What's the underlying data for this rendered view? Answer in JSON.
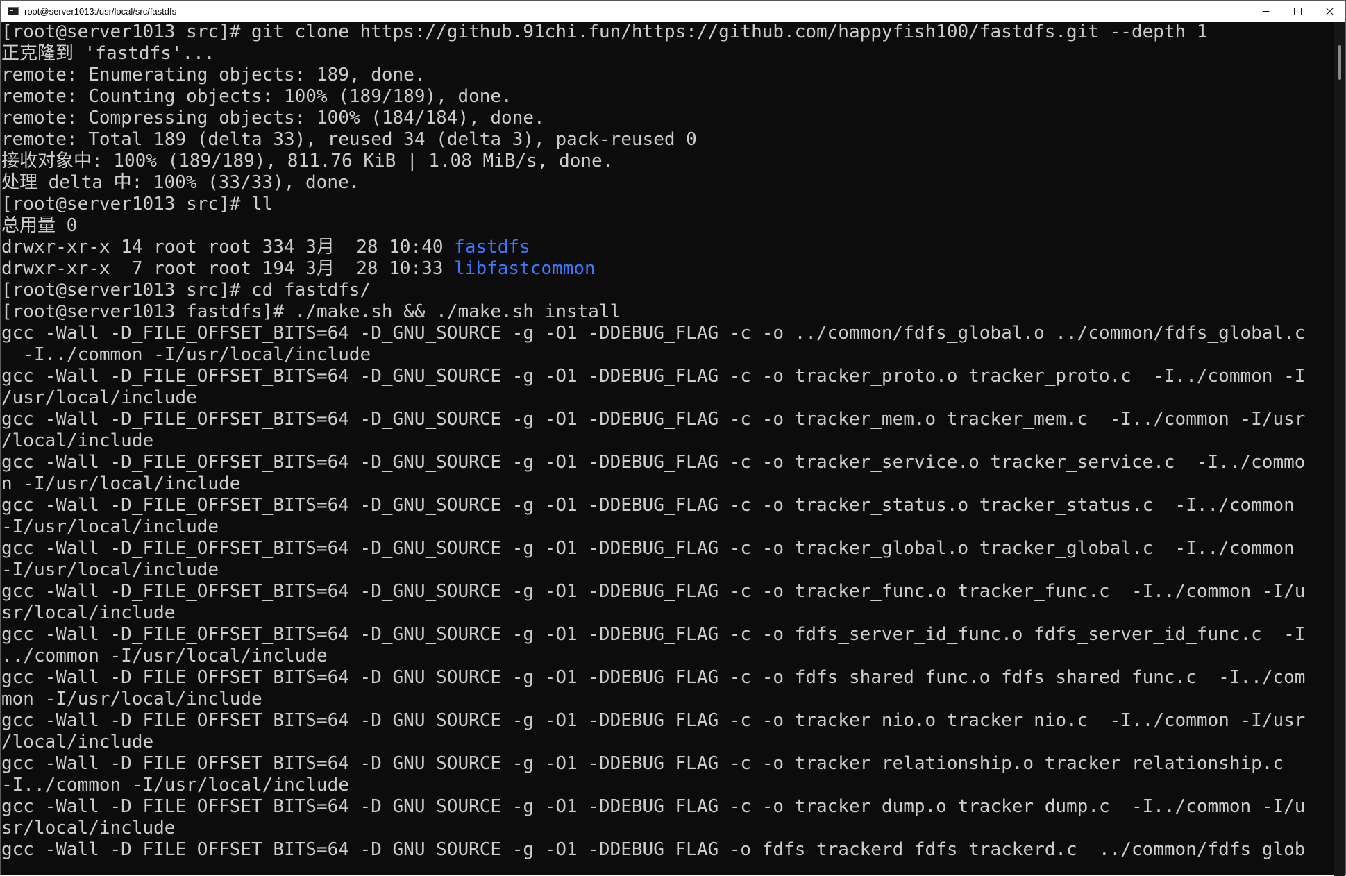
{
  "window": {
    "title": "root@server1013:/usr/local/src/fastdfs"
  },
  "controls": {
    "minimize": "–",
    "maximize": "☐",
    "close": "✕"
  },
  "terminal": {
    "lines": [
      "[root@server1013 src]# git clone https://github.91chi.fun/https://github.com/happyfish100/fastdfs.git --depth 1",
      "正克隆到 'fastdfs'...",
      "remote: Enumerating objects: 189, done.",
      "remote: Counting objects: 100% (189/189), done.",
      "remote: Compressing objects: 100% (184/184), done.",
      "remote: Total 189 (delta 33), reused 34 (delta 3), pack-reused 0",
      "接收对象中: 100% (189/189), 811.76 KiB | 1.08 MiB/s, done.",
      "处理 delta 中: 100% (33/33), done.",
      "[root@server1013 src]# ll",
      "总用量 0"
    ],
    "listing": [
      {
        "perms": "drwxr-xr-x 14 root root 334 3月  28 10:40 ",
        "name": "fastdfs"
      },
      {
        "perms": "drwxr-xr-x  7 root root 194 3月  28 10:33 ",
        "name": "libfastcommon"
      }
    ],
    "lines_after": [
      "[root@server1013 src]# cd fastdfs/",
      "[root@server1013 fastdfs]# ./make.sh && ./make.sh install",
      "gcc -Wall -D_FILE_OFFSET_BITS=64 -D_GNU_SOURCE -g -O1 -DDEBUG_FLAG -c -o ../common/fdfs_global.o ../common/fdfs_global.c",
      "  -I../common -I/usr/local/include",
      "gcc -Wall -D_FILE_OFFSET_BITS=64 -D_GNU_SOURCE -g -O1 -DDEBUG_FLAG -c -o tracker_proto.o tracker_proto.c  -I../common -I",
      "/usr/local/include",
      "gcc -Wall -D_FILE_OFFSET_BITS=64 -D_GNU_SOURCE -g -O1 -DDEBUG_FLAG -c -o tracker_mem.o tracker_mem.c  -I../common -I/usr",
      "/local/include",
      "gcc -Wall -D_FILE_OFFSET_BITS=64 -D_GNU_SOURCE -g -O1 -DDEBUG_FLAG -c -o tracker_service.o tracker_service.c  -I../commo",
      "n -I/usr/local/include",
      "gcc -Wall -D_FILE_OFFSET_BITS=64 -D_GNU_SOURCE -g -O1 -DDEBUG_FLAG -c -o tracker_status.o tracker_status.c  -I../common",
      "-I/usr/local/include",
      "gcc -Wall -D_FILE_OFFSET_BITS=64 -D_GNU_SOURCE -g -O1 -DDEBUG_FLAG -c -o tracker_global.o tracker_global.c  -I../common",
      "-I/usr/local/include",
      "gcc -Wall -D_FILE_OFFSET_BITS=64 -D_GNU_SOURCE -g -O1 -DDEBUG_FLAG -c -o tracker_func.o tracker_func.c  -I../common -I/u",
      "sr/local/include",
      "gcc -Wall -D_FILE_OFFSET_BITS=64 -D_GNU_SOURCE -g -O1 -DDEBUG_FLAG -c -o fdfs_server_id_func.o fdfs_server_id_func.c  -I",
      "../common -I/usr/local/include",
      "gcc -Wall -D_FILE_OFFSET_BITS=64 -D_GNU_SOURCE -g -O1 -DDEBUG_FLAG -c -o fdfs_shared_func.o fdfs_shared_func.c  -I../com",
      "mon -I/usr/local/include",
      "gcc -Wall -D_FILE_OFFSET_BITS=64 -D_GNU_SOURCE -g -O1 -DDEBUG_FLAG -c -o tracker_nio.o tracker_nio.c  -I../common -I/usr",
      "/local/include",
      "gcc -Wall -D_FILE_OFFSET_BITS=64 -D_GNU_SOURCE -g -O1 -DDEBUG_FLAG -c -o tracker_relationship.o tracker_relationship.c",
      "-I../common -I/usr/local/include",
      "gcc -Wall -D_FILE_OFFSET_BITS=64 -D_GNU_SOURCE -g -O1 -DDEBUG_FLAG -c -o tracker_dump.o tracker_dump.c  -I../common -I/u",
      "sr/local/include",
      "gcc -Wall -D_FILE_OFFSET_BITS=64 -D_GNU_SOURCE -g -O1 -DDEBUG_FLAG -o fdfs_trackerd fdfs_trackerd.c  ../common/fdfs_glob"
    ]
  },
  "colors": {
    "background": "#0c0c0c",
    "text": "#cccccc",
    "directory": "#3b78ff"
  },
  "icons": {
    "app": "terminal-app-icon",
    "minimize": "minimize-icon",
    "maximize": "maximize-icon",
    "close": "close-icon"
  }
}
